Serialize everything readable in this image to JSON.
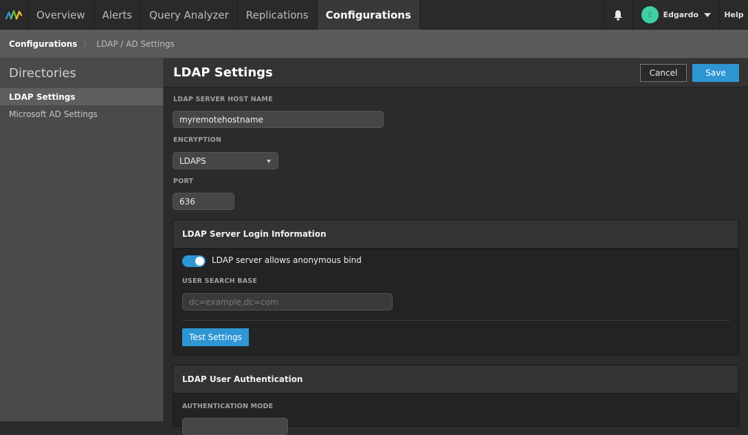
{
  "nav": {
    "logo": "app-logo",
    "items": [
      {
        "label": "Overview",
        "active": false
      },
      {
        "label": "Alerts",
        "active": false
      },
      {
        "label": "Query Analyzer",
        "active": false
      },
      {
        "label": "Replications",
        "active": false
      },
      {
        "label": "Configurations",
        "active": true
      }
    ],
    "bell_icon": "bell-icon",
    "user": {
      "initial": "E",
      "name": "Edgardo",
      "avatar_color": "#3fcfa6"
    },
    "help_label": "Help"
  },
  "breadcrumb": {
    "root": "Configurations",
    "separator": "〉",
    "current": "LDAP / AD Settings"
  },
  "sidebar": {
    "title": "Directories",
    "items": [
      {
        "label": "LDAP Settings",
        "active": true
      },
      {
        "label": "Microsoft AD Settings",
        "active": false
      }
    ]
  },
  "main": {
    "title": "LDAP Settings",
    "cancel_label": "Cancel",
    "save_label": "Save",
    "accent_color": "#2f96d4",
    "fields": {
      "host_label": "LDAP SERVER HOST NAME",
      "host_value": "myremotehostname",
      "encryption_label": "ENCRYPTION",
      "encryption_value": "LDAPS",
      "port_label": "PORT",
      "port_value": "636"
    },
    "login_panel": {
      "title": "LDAP Server Login Information",
      "anonymous_bind_label": "LDAP server allows anonymous bind",
      "anonymous_bind_on": true,
      "search_base_label": "USER SEARCH BASE",
      "search_base_value": "",
      "search_base_placeholder": "dc=example,dc=com",
      "test_button_label": "Test Settings"
    },
    "auth_panel": {
      "title": "LDAP User Authentication",
      "mode_label": "AUTHENTICATION MODE"
    }
  }
}
